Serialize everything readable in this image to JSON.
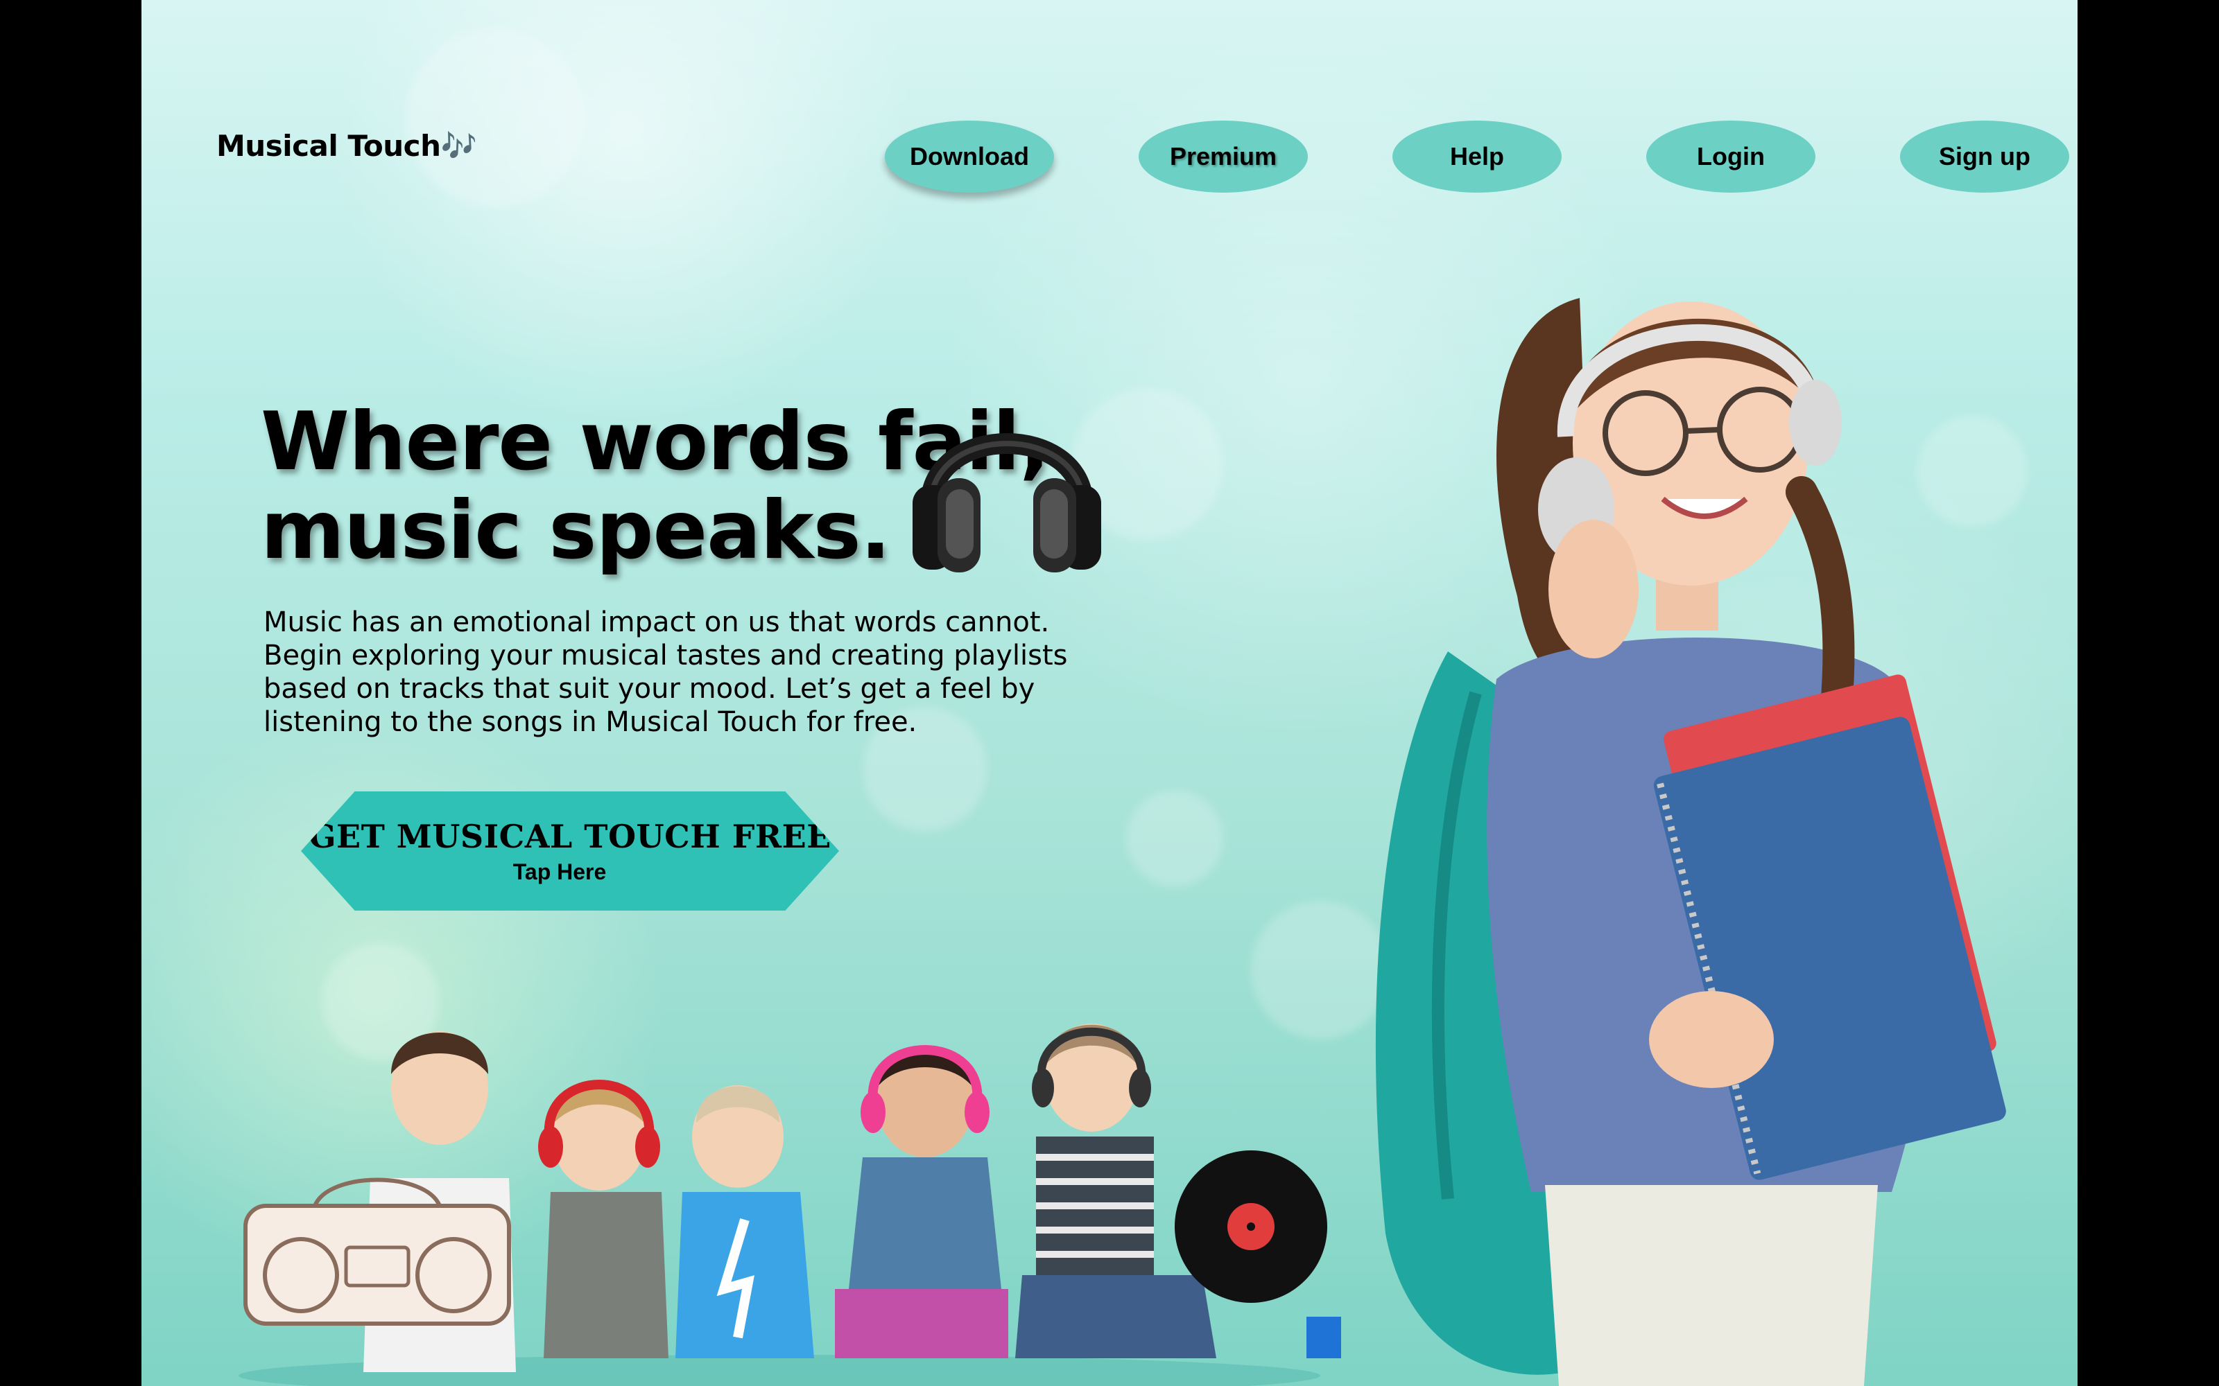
{
  "brand": {
    "name": "Musical Touch🎶"
  },
  "nav": {
    "items": [
      {
        "label": "Download"
      },
      {
        "label": "Premium"
      },
      {
        "label": "Help"
      },
      {
        "label": "Login"
      },
      {
        "label": "Sign up"
      }
    ]
  },
  "hero": {
    "headline_line1": "Where words fail,",
    "headline_line2": "music speaks.",
    "body_lines": [
      "Music has an emotional impact on us that words cannot.",
      "Begin exploring your musical tastes and creating playlists",
      "based on tracks that suit your mood. Let’s get a feel by",
      "listening to the songs in Musical Touch for free."
    ],
    "cta_label": "GET MUSICAL TOUCH FREE",
    "cta_sublabel": "Tap Here"
  },
  "icons": [
    "headphones-icon"
  ],
  "colors": {
    "nav_button": "#6dd0c4",
    "cta_button": "#2fc1b6",
    "background_top": "#d8f5f3",
    "background_bottom": "#7fd4c5"
  }
}
